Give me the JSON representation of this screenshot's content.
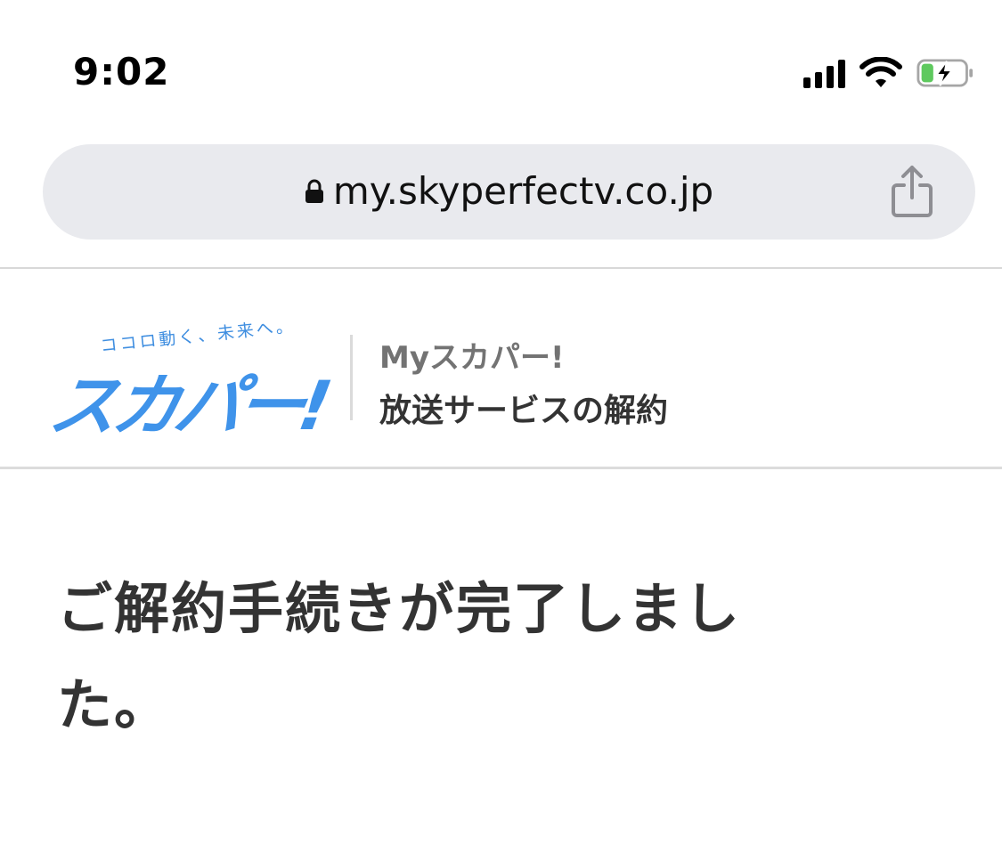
{
  "status_bar": {
    "time": "9:02",
    "icons": [
      "cellular-signal-icon",
      "wifi-icon",
      "battery-charging-icon"
    ],
    "battery_color": "#5ec95e"
  },
  "browser": {
    "url": "my.skyperfectv.co.jp",
    "lock_icon": "lock-icon",
    "share_icon": "share-icon"
  },
  "header": {
    "logo_tagline": "ココロ動く、未来へ。",
    "logo_text": "スカパー!",
    "subtitle": "Myスカパー!",
    "title": "放送サービスの解約",
    "brand_color": "#3f93ea"
  },
  "main": {
    "message": "ご解約手続きが完了しました。"
  }
}
